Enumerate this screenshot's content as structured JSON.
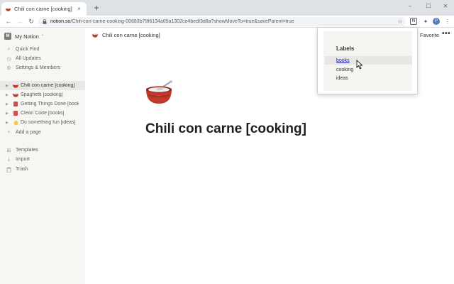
{
  "browser": {
    "tab_title": "Chili con carne [cooking]",
    "tab_close": "×",
    "new_tab": "+",
    "window_controls": {
      "minimize": "–",
      "maximize": "☐",
      "close": "✕"
    },
    "url_host": "notion.so",
    "url_path": "/Chili-con-carne-cooking-00683b79f6134a05a1302ce4bedf3d8a?showMoveTo=true&saveParent=true",
    "nav": {
      "back": "←",
      "forward": "→",
      "reload": "↻"
    },
    "toolbar_icons": {
      "star": "☆",
      "active_extension": "N",
      "extensions": "✦",
      "profile": "P",
      "menu": "⋮"
    }
  },
  "sidebar": {
    "workspace_logo": "M",
    "workspace_name": "My Notion",
    "workspace_chevron": "⌃",
    "nav_items": [
      {
        "label": "Quick Find",
        "icon": "⌕"
      },
      {
        "label": "All Updates",
        "icon": "◷"
      },
      {
        "label": "Settings & Members",
        "icon": "⚙"
      }
    ],
    "pages": [
      {
        "label": "Chili con carne [cooking]",
        "icon": "bowl"
      },
      {
        "label": "Spaghetti [cooking]",
        "icon": "bowl"
      },
      {
        "label": "Getting Things Done [books]",
        "icon": "book"
      },
      {
        "label": "Clean Code [books]",
        "icon": "book"
      },
      {
        "label": "Do something fun [ideas]",
        "icon": "bulb"
      }
    ],
    "add_page": {
      "label": "Add a page",
      "icon": "+"
    },
    "footer_items": [
      {
        "label": "Templates",
        "icon": "⊞"
      },
      {
        "label": "Import",
        "icon": "⤓"
      },
      {
        "label": "Trash",
        "icon": "🗑"
      }
    ],
    "expand_arrow": "▶"
  },
  "main": {
    "breadcrumb": "Chili con carne [cooking]",
    "favorite": "Favorite",
    "more": "•••",
    "page_title": "Chili con carne [cooking]"
  },
  "popup": {
    "title": "Labels",
    "labels": [
      "books",
      "cooking",
      "ideas"
    ]
  },
  "colors": {
    "sidebar_bg": "#f7f6f3",
    "popup_bg": "#f6f5f1",
    "link": "#1a1aa6",
    "bowl": "#c0392b"
  }
}
